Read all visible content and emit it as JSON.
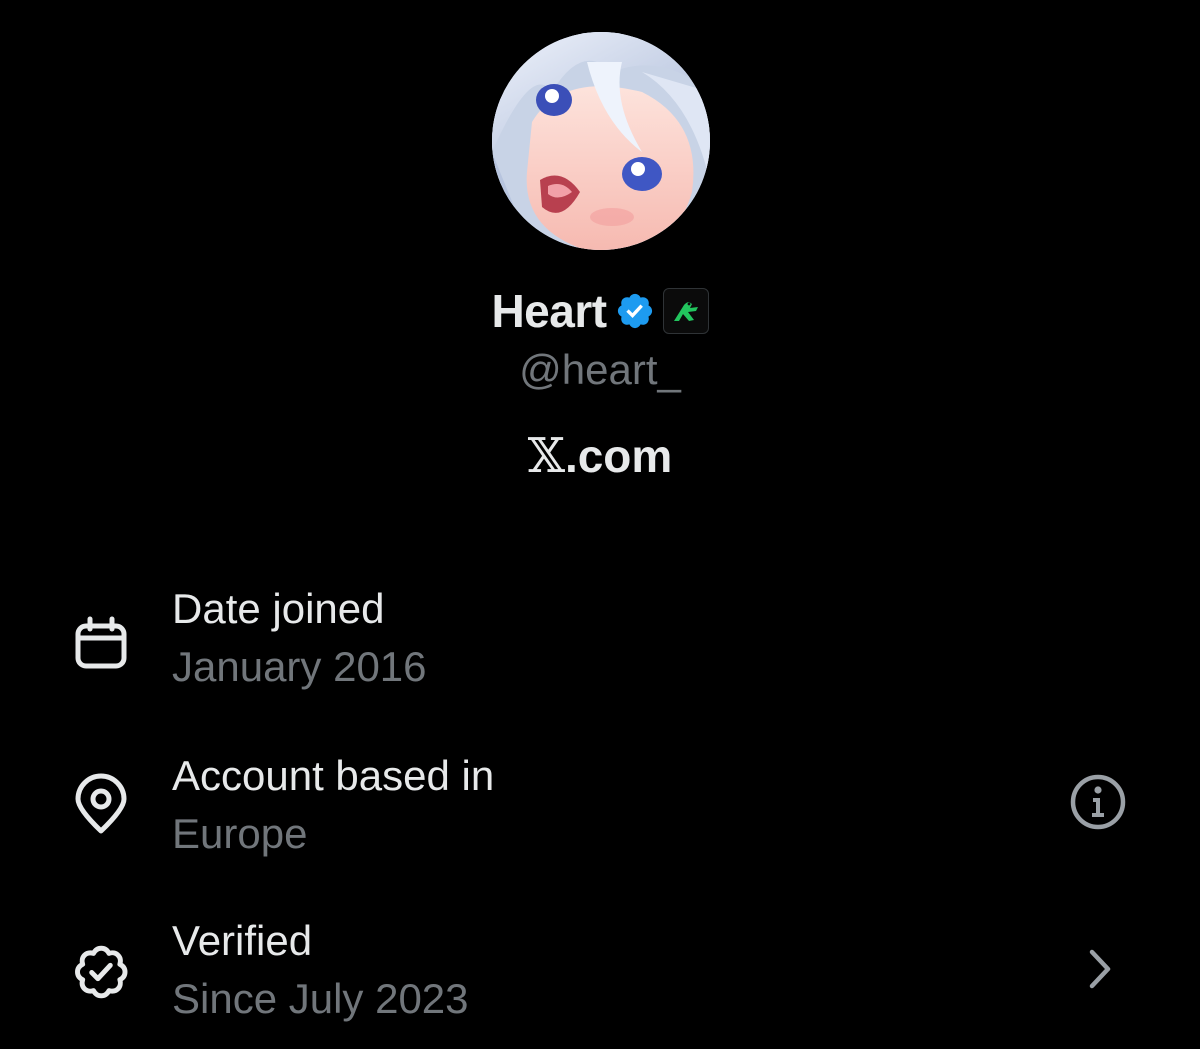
{
  "profile": {
    "display_name": "Heart",
    "handle": "@heart_",
    "verified_badge_icon": "verified-check-icon",
    "affiliate_badge_icon": "affiliate-frog-icon",
    "platform_mark": "𝕏",
    "platform_suffix": ".com"
  },
  "info": {
    "date_joined": {
      "icon": "calendar-icon",
      "title": "Date joined",
      "value": "January 2016"
    },
    "account_based_in": {
      "icon": "location-pin-icon",
      "title": "Account based in",
      "value": "Europe",
      "action_icon": "info-icon"
    },
    "verified": {
      "icon": "verified-badge-outline-icon",
      "title": "Verified",
      "value": "Since July 2023",
      "action_icon": "chevron-right-icon"
    }
  },
  "colors": {
    "background": "#000000",
    "primary_text": "#e7e9ea",
    "secondary_text": "#71767b",
    "verified_blue": "#1d9bf0",
    "affiliate_green": "#22c55e"
  }
}
